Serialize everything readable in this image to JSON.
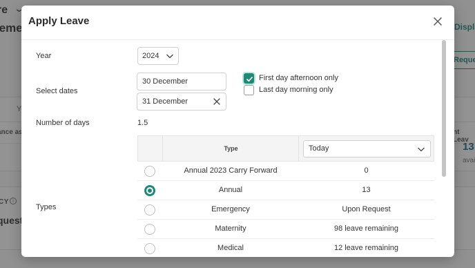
{
  "background": {
    "dropdown_fragment": "re",
    "title_fragment": "leme",
    "display_fragment": "Displa",
    "request_button_fragment": "Reques",
    "tab_fragment": "Y",
    "left_column_fragment": "ance as",
    "right_column_fragment": "nt Leav",
    "big_number_fragment": "13",
    "avail_fragment": "avai",
    "policy_fragment": "CY",
    "request_label_fragment": "quest"
  },
  "modal": {
    "title": "Apply Leave",
    "labels": {
      "year": "Year",
      "select_dates": "Select dates",
      "number_of_days": "Number of days",
      "types": "Types"
    },
    "year_value": "2024",
    "start_date": "30 December",
    "end_date": "31 December",
    "first_day_afternoon": {
      "label": "First day afternoon only",
      "checked": true
    },
    "last_day_morning": {
      "label": "Last day morning only",
      "checked": false
    },
    "number_of_days_value": "1.5",
    "types_table": {
      "type_header": "Type",
      "filter_value": "Today",
      "rows": [
        {
          "type": "Annual 2023 Carry Forward",
          "balance": "0",
          "selected": false
        },
        {
          "type": "Annual",
          "balance": "13",
          "selected": true
        },
        {
          "type": "Emergency",
          "balance": "Upon Request",
          "selected": false
        },
        {
          "type": "Maternity",
          "balance": "98 leave remaining",
          "selected": false
        },
        {
          "type": "Medical",
          "balance": "12 leave remaining",
          "selected": false
        }
      ]
    }
  },
  "colors": {
    "accent": "#1d8a78",
    "overlay": "#282828"
  }
}
